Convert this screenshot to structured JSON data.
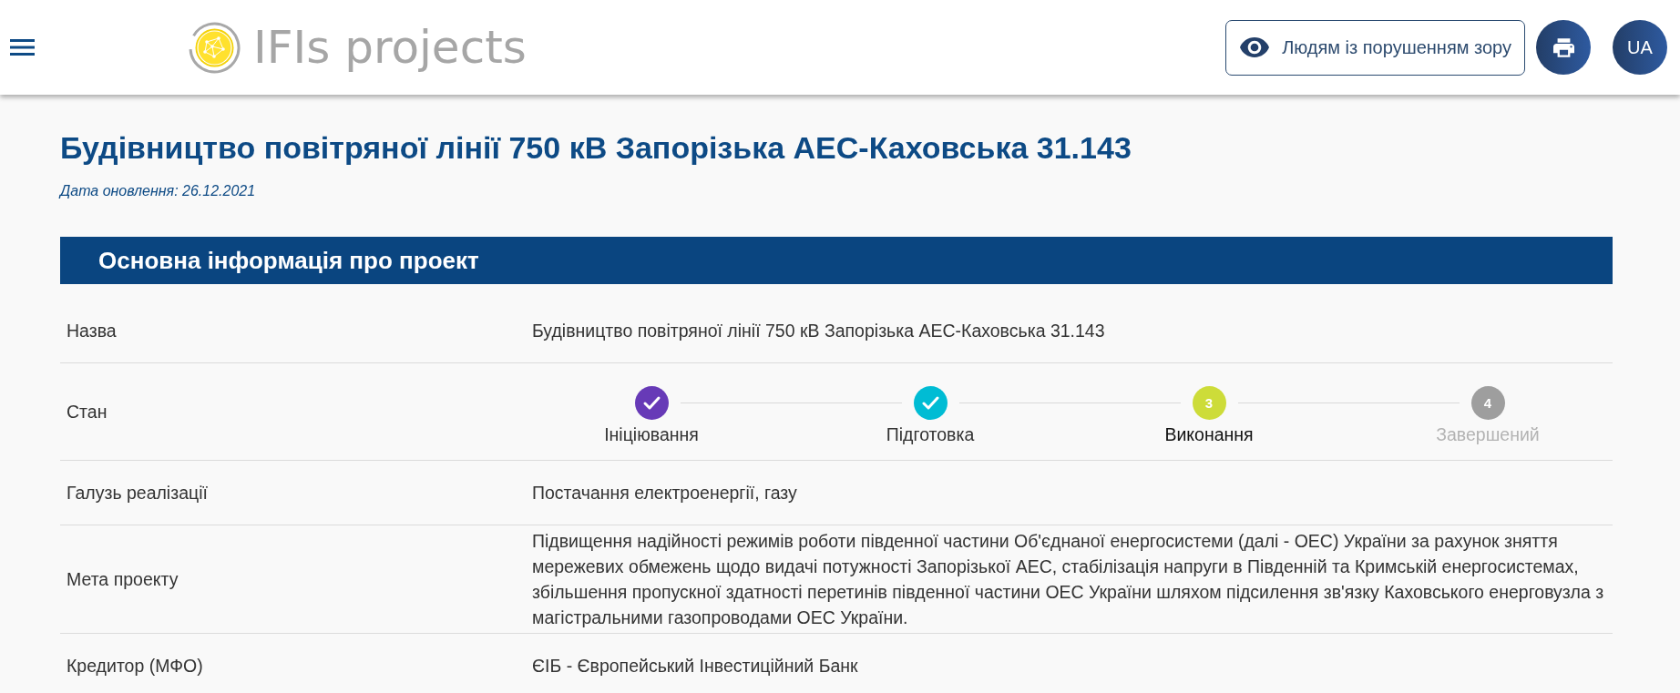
{
  "header": {
    "logo_text": "IFIs projects",
    "accessibility_button": "Людям із порушенням зору",
    "language_button": "UA"
  },
  "page": {
    "title": "Будівництво повітряної лінії 750 кВ Запорізька АЕС-Каховська 31.143",
    "updated": "Дата оновлення: 26.12.2021"
  },
  "section": {
    "title": "Основна інформація про проект",
    "rows": [
      {
        "kind": "text",
        "label": "Назва",
        "value": "Будівництво повітряної лінії 750 кВ Запорізька АЕС-Каховська 31.143"
      },
      {
        "kind": "steps",
        "label": "Стан",
        "steps": [
          {
            "label": "Ініціювання",
            "completed": true,
            "current": false,
            "color": "#673ab7"
          },
          {
            "label": "Підготовка",
            "completed": true,
            "current": false,
            "color": "#00bcd4"
          },
          {
            "label": "Виконання",
            "completed": false,
            "current": true,
            "number": "3",
            "color": "#cddc39"
          },
          {
            "label": "Завершений",
            "completed": false,
            "current": false,
            "number": "4",
            "color": "#9e9e9e"
          }
        ]
      },
      {
        "kind": "text",
        "label": "Галузь реалізації",
        "value": "Постачання електроенергії, газу"
      },
      {
        "kind": "text",
        "label": "Мета проекту",
        "value": "Підвищення надійності режимів роботи південної частини Об'єднаної енергосистеми (далі - ОЕС) України за рахунок зняття мережевих обмежень щодо видачі потужності Запорізької АЕС, стабілізація напруги в Південній та Кримській енергосистемах, збільшення пропускної здатності перетинів південної частини ОЕС України шляхом підсилення зв'язку Каховського енерговузла з магістральними газопроводами ОЕС України."
      },
      {
        "kind": "text",
        "label": "Кредитор (МФО)",
        "value": "ЄІБ - Європейський Інвестиційний Банк"
      }
    ]
  }
}
